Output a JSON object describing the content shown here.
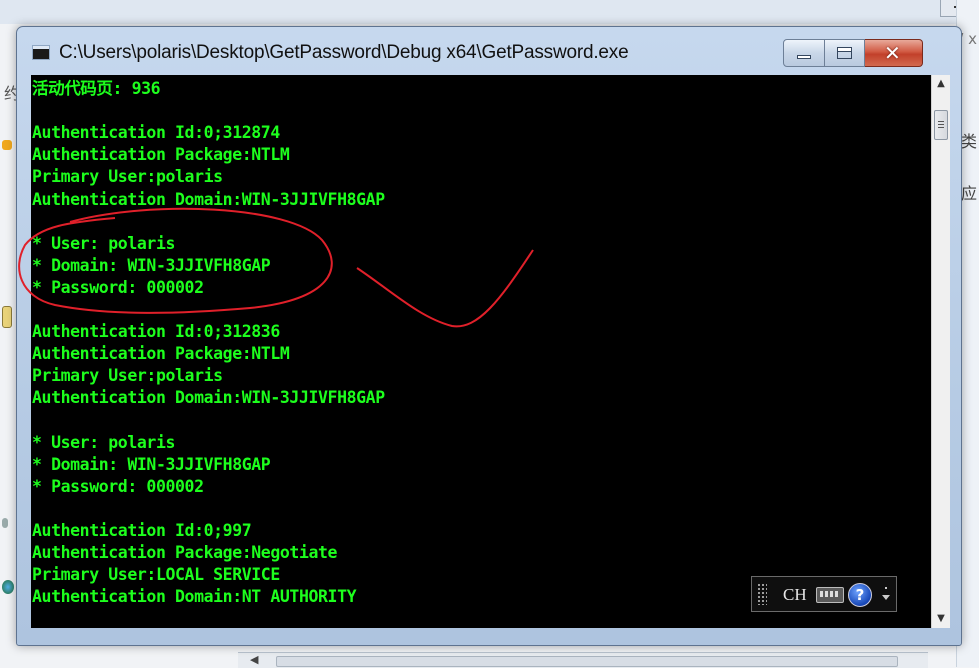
{
  "window": {
    "title": "C:\\Users\\polaris\\Desktop\\GetPassword\\Debug x64\\GetPassword.exe",
    "icon": "console-app-icon",
    "buttons": {
      "minimize": "minimize-icon",
      "maximize": "maximize-icon",
      "close": "close-icon"
    }
  },
  "console": {
    "text_color": "#1dff1d",
    "background": "#000000",
    "lines": [
      "活动代码页: 936",
      "",
      "Authentication Id:0;312874",
      "Authentication Package:NTLM",
      "Primary User:polaris",
      "Authentication Domain:WIN-3JJIVFH8GAP",
      "",
      "* User: polaris",
      "* Domain: WIN-3JJIVFH8GAP",
      "* Password: 000002",
      "",
      "Authentication Id:0;312836",
      "Authentication Package:NTLM",
      "Primary User:polaris",
      "Authentication Domain:WIN-3JJIVFH8GAP",
      "",
      "* User: polaris",
      "* Domain: WIN-3JJIVFH8GAP",
      "* Password: 000002",
      "",
      "Authentication Id:0;997",
      "Authentication Package:Negotiate",
      "Primary User:LOCAL SERVICE",
      "Authentication Domain:NT AUTHORITY"
    ]
  },
  "annotation": {
    "color": "#e0202a",
    "shapes": [
      "ellipse-circle",
      "check-mark-stroke"
    ]
  },
  "language_bar": {
    "language": "CH",
    "keyboard": "keyboard-icon",
    "help": "?",
    "options": "options-arrow-icon"
  },
  "background": {
    "left_chars": [
      "约"
    ],
    "right_chars": [
      "/ x",
      "类",
      "应"
    ]
  }
}
